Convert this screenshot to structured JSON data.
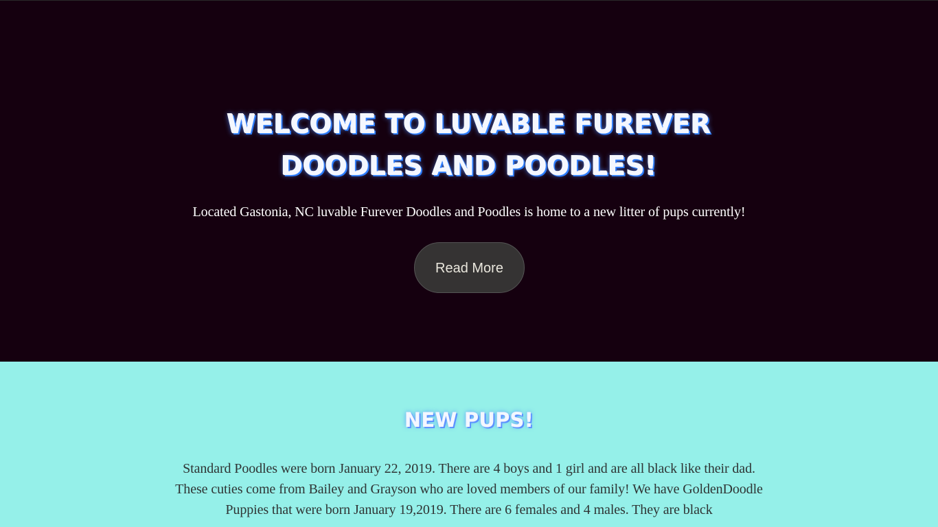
{
  "hero": {
    "title": "Welcome to Luvable Furever Doodles and Poodles!",
    "subtitle": "Located Gastonia, NC luvable Furever Doodles and Poodles is home to a new litter of pups currently!",
    "button_label": "Read More"
  },
  "pups": {
    "title": "New Pups!",
    "text": "Standard Poodles were born January 22, 2019. There are 4 boys and 1 girl and are all black like their dad. These cuties come from Bailey and Grayson who are loved members of our family! We have GoldenDoodle Puppies that were born January 19,2019. There are 6 females and 4 males. They are black"
  },
  "colors": {
    "hero_background": "#15000f",
    "section_background": "#95f0e9",
    "button_background": "#353333",
    "heading_glow": "#2b7cff"
  }
}
